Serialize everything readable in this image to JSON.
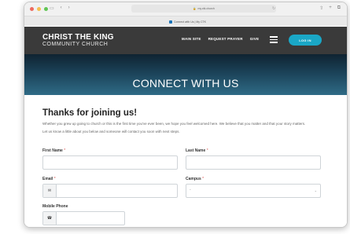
{
  "browser": {
    "url": "my.ctk.church",
    "tab_title": "Connect with Us | My CTK",
    "nav_icons": [
      "sidebar-icon",
      "back-icon",
      "forward-icon"
    ],
    "right_icons": [
      "share-icon",
      "new-tab-icon",
      "tabs-overview-icon"
    ]
  },
  "header": {
    "logo_line1": "CHRIST THE KING",
    "logo_line2": "COMMUNITY CHURCH",
    "nav": [
      "MAIN SITE",
      "REQUEST PRAYER",
      "GIVE"
    ],
    "login_label": "LOG IN",
    "accent_color": "#1aa7c6"
  },
  "hero": {
    "title": "CONNECT WITH US"
  },
  "form": {
    "heading": "Thanks for joining us!",
    "intro": "Whether you grew up going to church or this is the first time you've ever been, we hope you feel welcomed here. We believe that you matter and that your story matters.",
    "intro2": "Let us know a little about you below and someone will contact you soon with next steps.",
    "first_name_label": "First Name",
    "last_name_label": "Last Name",
    "email_label": "Email",
    "campus_label": "Campus",
    "campus_value": "-",
    "mobile_label": "Mobile Phone",
    "required_marker": "*"
  }
}
